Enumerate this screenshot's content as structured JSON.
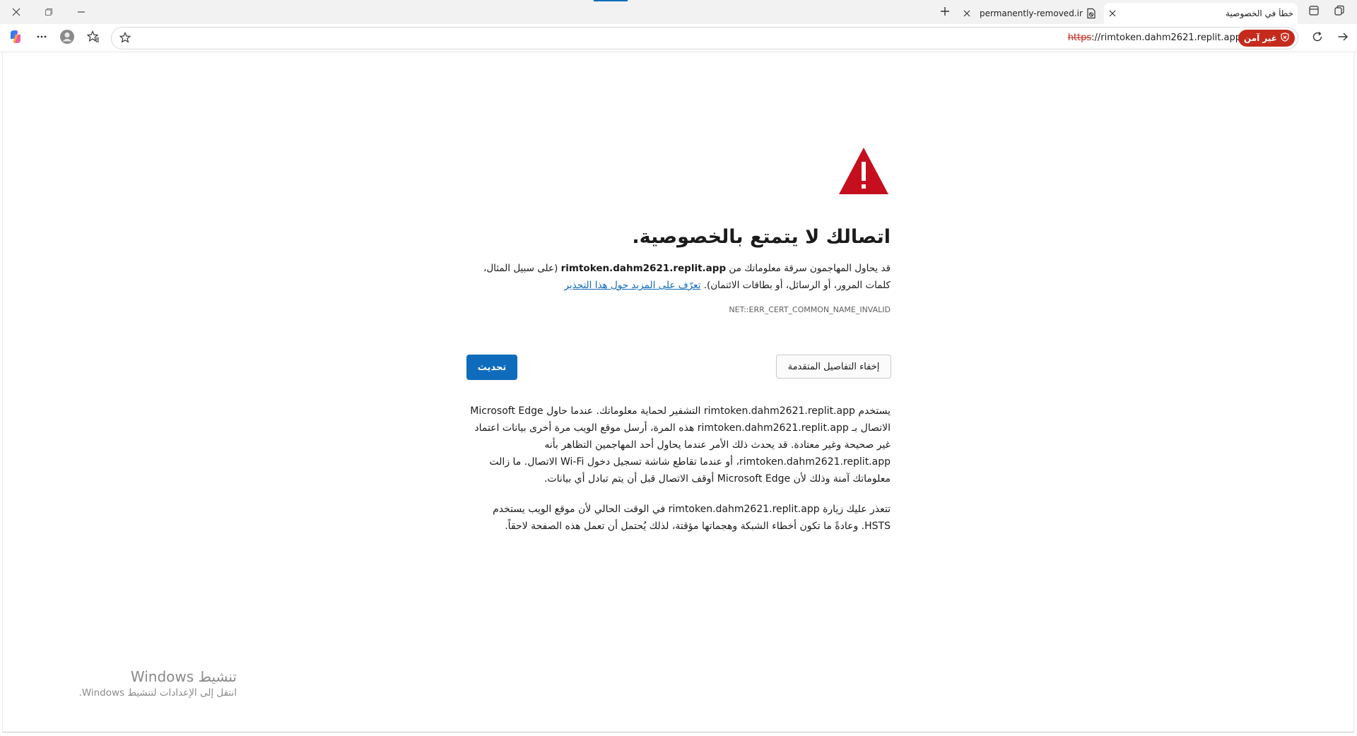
{
  "tabs": {
    "inactive": {
      "title": "permanently-removed.invalid"
    },
    "active": {
      "title": "خطأ في الخصوصية"
    }
  },
  "addressbar": {
    "url_scheme": "https",
    "url_rest": "://rimtoken.dahm2621.replit.app",
    "security_label": "غير آمن"
  },
  "error_page": {
    "heading": "اتصالك لا يتمتع بالخصوصية.",
    "desc_prefix": "قد يحاول المهاجمون سرقة معلوماتك من ",
    "desc_host": "rimtoken.dahm2621.replit.app",
    "desc_suffix": " (على سبيل المثال، كلمات المرور، أو الرسائل، أو بطاقات الائتمان). ",
    "learn_more_link": "تعرّف على المزيد حول هذا التحذير",
    "error_code": "NET::ERR_CERT_COMMON_NAME_INVALID",
    "hide_advanced_button": "إخفاء التفاصيل المتقدمة",
    "refresh_button": "تحديث",
    "advanced_paragraph_1": "يستخدم rimtoken.dahm2621.replit.app التشفير لحماية معلوماتك. عندما حاول Microsoft Edge الاتصال بـ rimtoken.dahm2621.replit.app هذه المرة، أرسل موقع الويب مرة أخرى بيانات اعتماد غير صحيحة وغير معتادة. قد يحدث ذلك الأمر عندما يحاول أحد المهاجمين التظاهر بأنه rimtoken.dahm2621.replit.app، أو عندما تقاطع شاشة تسجيل دخول Wi-Fi الاتصال. ما زالت معلوماتك آمنة وذلك لأن Microsoft Edge أوقف الاتصال قبل أن يتم تبادل أي بيانات.",
    "advanced_paragraph_2": "تتعذر عليك زيارة rimtoken.dahm2621.replit.app في الوقت الحالي لأن موقع الويب يستخدم HSTS. وعادةً ما تكون أخطاء الشبكة وهجماتها مؤقتة، لذلك يُحتمل أن تعمل هذه الصفحة لاحقاً."
  },
  "watermark": {
    "title": "تنشيط Windows",
    "subtitle": "انتقل إلى الإعدادات لتنشيط Windows."
  },
  "colors": {
    "accent": "#0f6cbd",
    "danger": "#c42b1c",
    "warning_triangle": "#c50f1f"
  },
  "icons": [
    "close-icon",
    "restore-icon",
    "minimize-icon",
    "new-tab-icon",
    "tab-close-icon",
    "page-error-icon",
    "tab-actions-icon",
    "workspaces-icon",
    "copilot-icon",
    "more-icon",
    "profile-icon",
    "favorites-icon",
    "star-icon",
    "shield-icon",
    "refresh-icon",
    "forward-icon",
    "warning-icon"
  ]
}
